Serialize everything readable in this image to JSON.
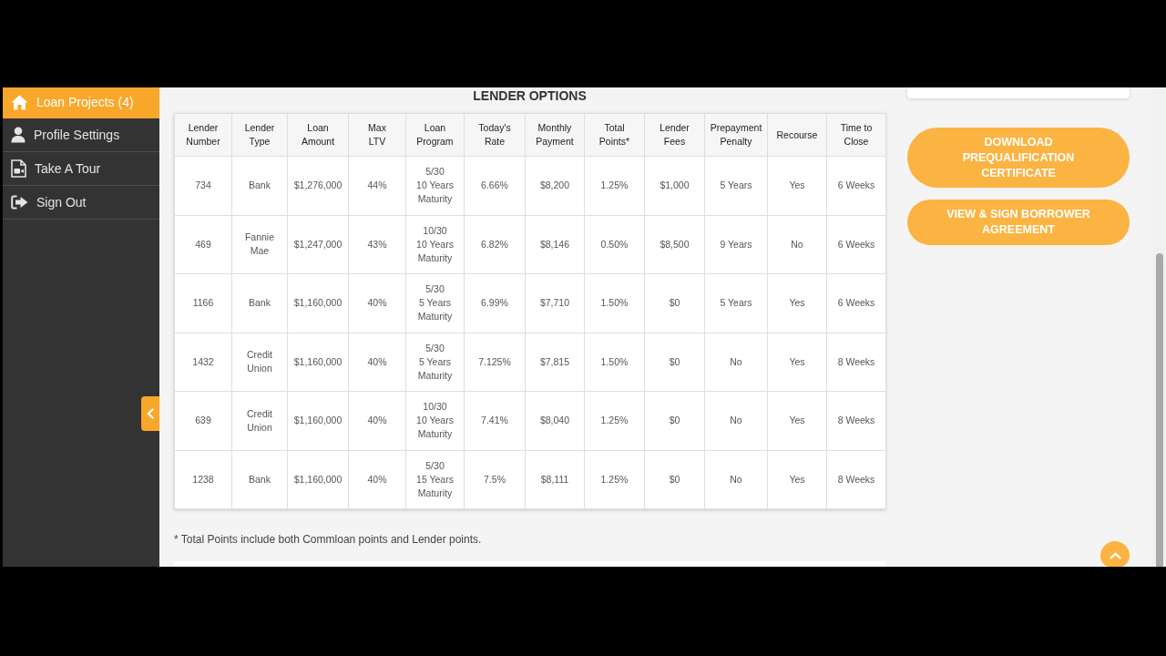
{
  "sidebar": {
    "items": [
      {
        "label": "Loan Projects (4)",
        "selected": true
      },
      {
        "label": "Profile Settings",
        "selected": false
      },
      {
        "label": "Take A Tour",
        "selected": false
      },
      {
        "label": "Sign Out",
        "selected": false
      }
    ]
  },
  "lender_options": {
    "title": "LENDER OPTIONS",
    "columns": [
      "Lender\nNumber",
      "Lender\nType",
      "Loan\nAmount",
      "Max\nLTV",
      "Loan\nProgram",
      "Today's\nRate",
      "Monthly\nPayment",
      "Total\nPoints*",
      "Lender\nFees",
      "Prepayment\nPenalty",
      "Recourse",
      "Time to\nClose"
    ],
    "rows": [
      [
        "734",
        "Bank",
        "$1,276,000",
        "44%",
        "5/30\n10 Years Maturity",
        "6.66%",
        "$8,200",
        "1.25%",
        "$1,000",
        "5 Years",
        "Yes",
        "6 Weeks"
      ],
      [
        "469",
        "Fannie Mae",
        "$1,247,000",
        "43%",
        "10/30\n10 Years Maturity",
        "6.82%",
        "$8,146",
        "0.50%",
        "$8,500",
        "9 Years",
        "No",
        "6 Weeks"
      ],
      [
        "1166",
        "Bank",
        "$1,160,000",
        "40%",
        "5/30\n5 Years Maturity",
        "6.99%",
        "$7,710",
        "1.50%",
        "$0",
        "5 Years",
        "Yes",
        "6 Weeks"
      ],
      [
        "1432",
        "Credit Union",
        "$1,160,000",
        "40%",
        "5/30\n5 Years Maturity",
        "7.125%",
        "$7,815",
        "1.50%",
        "$0",
        "No",
        "Yes",
        "8 Weeks"
      ],
      [
        "639",
        "Credit Union",
        "$1,160,000",
        "40%",
        "10/30\n10 Years Maturity",
        "7.41%",
        "$8,040",
        "1.25%",
        "$0",
        "No",
        "Yes",
        "8 Weeks"
      ],
      [
        "1238",
        "Bank",
        "$1,160,000",
        "40%",
        "5/30\n15 Years Maturity",
        "7.5%",
        "$8,111",
        "1.25%",
        "$0",
        "No",
        "Yes",
        "8 Weeks"
      ]
    ],
    "footnote": "* Total Points include both Commloan points and Lender points."
  },
  "actions": [
    "DOWNLOAD PREQUALIFICATION CERTIFICATE",
    "VIEW & SIGN BORROWER AGREEMENT"
  ]
}
